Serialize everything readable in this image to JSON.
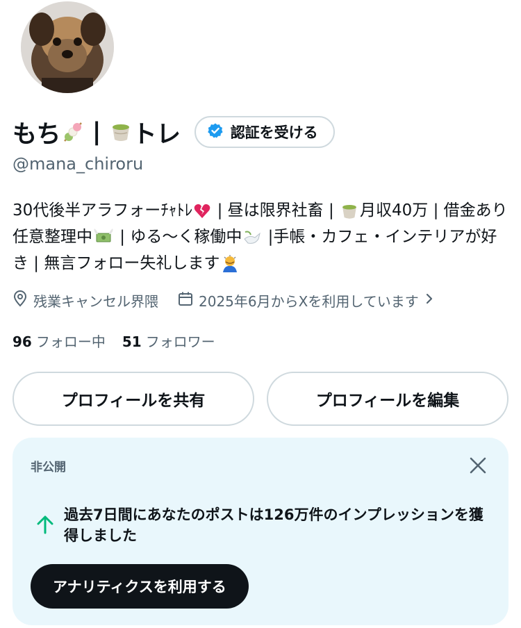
{
  "profile": {
    "name_part1": "もち",
    "name_separator": " | ",
    "name_part2": "トレ",
    "name_emoji1": "dango-emoji",
    "name_emoji2": "green-tea-emoji",
    "verify_button": "認証を受ける",
    "handle": "@mana_chiroru",
    "bio": {
      "segments": [
        "30代後半アラフォーﾁｬﾄﾚ",
        " | 昼は限界社畜 | ",
        "月収40万 | 借金あり任意整理中",
        " | ゆる〜く稼働中",
        " |手帳・カフェ・インテリアが好き | 無言フォロー失礼します"
      ]
    },
    "location": "残業キャンセル界隈",
    "joined": "2025年6月からXを利用しています",
    "following_count": "96",
    "following_label": "フォロー中",
    "followers_count": "51",
    "followers_label": "フォロワー",
    "share_button": "プロフィールを共有",
    "edit_button": "プロフィールを編集"
  },
  "card": {
    "label": "非公開",
    "message": "過去7日間にあなたのポストは126万件のインプレッションを獲得しました",
    "button": "アナリティクスを利用する"
  },
  "colors": {
    "text": "#0f1419",
    "secondary_text": "#536471",
    "border": "#cfd9de",
    "card_bg": "#e9f7fc",
    "verify_blue": "#1d9bf0",
    "up_arrow_green": "#00ba7c"
  }
}
